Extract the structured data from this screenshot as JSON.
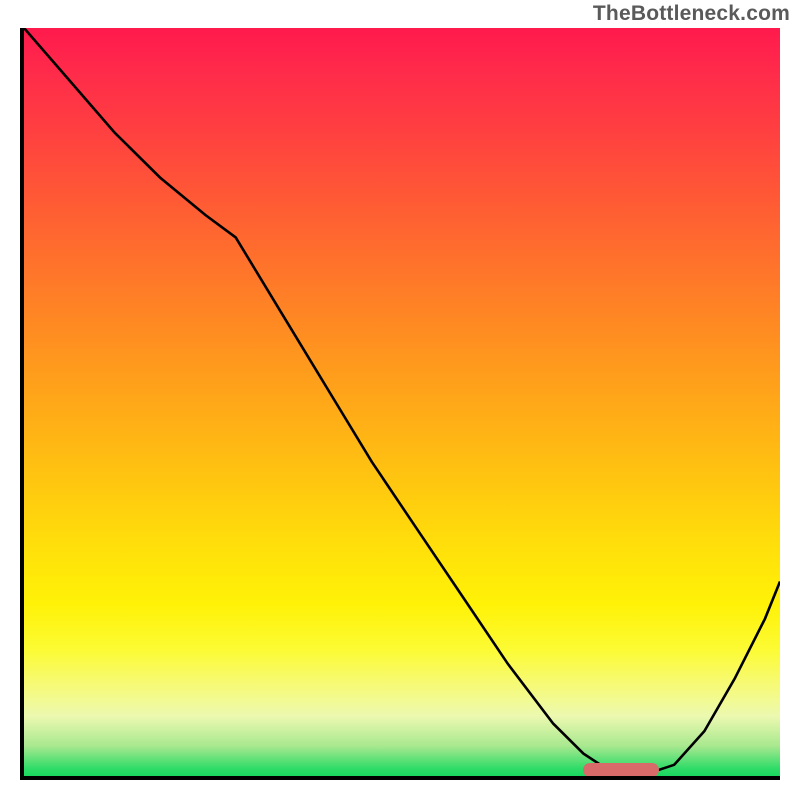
{
  "watermark": "TheBottleneck.com",
  "colors": {
    "gradient_top": "#ff1a4d",
    "gradient_mid": "#ffca0f",
    "gradient_bottom": "#18d85f",
    "axis": "#000000",
    "curve": "#000000",
    "bar": "#d86a6a"
  },
  "chart_data": {
    "type": "line",
    "title": "",
    "xlabel": "",
    "ylabel": "",
    "xlim": [
      0,
      100
    ],
    "ylim": [
      0,
      100
    ],
    "grid": false,
    "series": [
      {
        "name": "bottleneck-curve",
        "x": [
          0,
          6,
          12,
          18,
          24,
          28,
          34,
          40,
          46,
          52,
          58,
          64,
          70,
          74,
          77,
          80,
          83,
          86,
          90,
          94,
          98,
          100
        ],
        "y": [
          100,
          93,
          86,
          80,
          75,
          72,
          62,
          52,
          42,
          33,
          24,
          15,
          7,
          3,
          1,
          0.5,
          0.5,
          1.5,
          6,
          13,
          21,
          26
        ]
      }
    ],
    "annotations": [
      {
        "name": "optimal-range-bar",
        "x_start": 74,
        "x_end": 84,
        "y": 0.8,
        "color": "#d86a6a"
      }
    ]
  }
}
